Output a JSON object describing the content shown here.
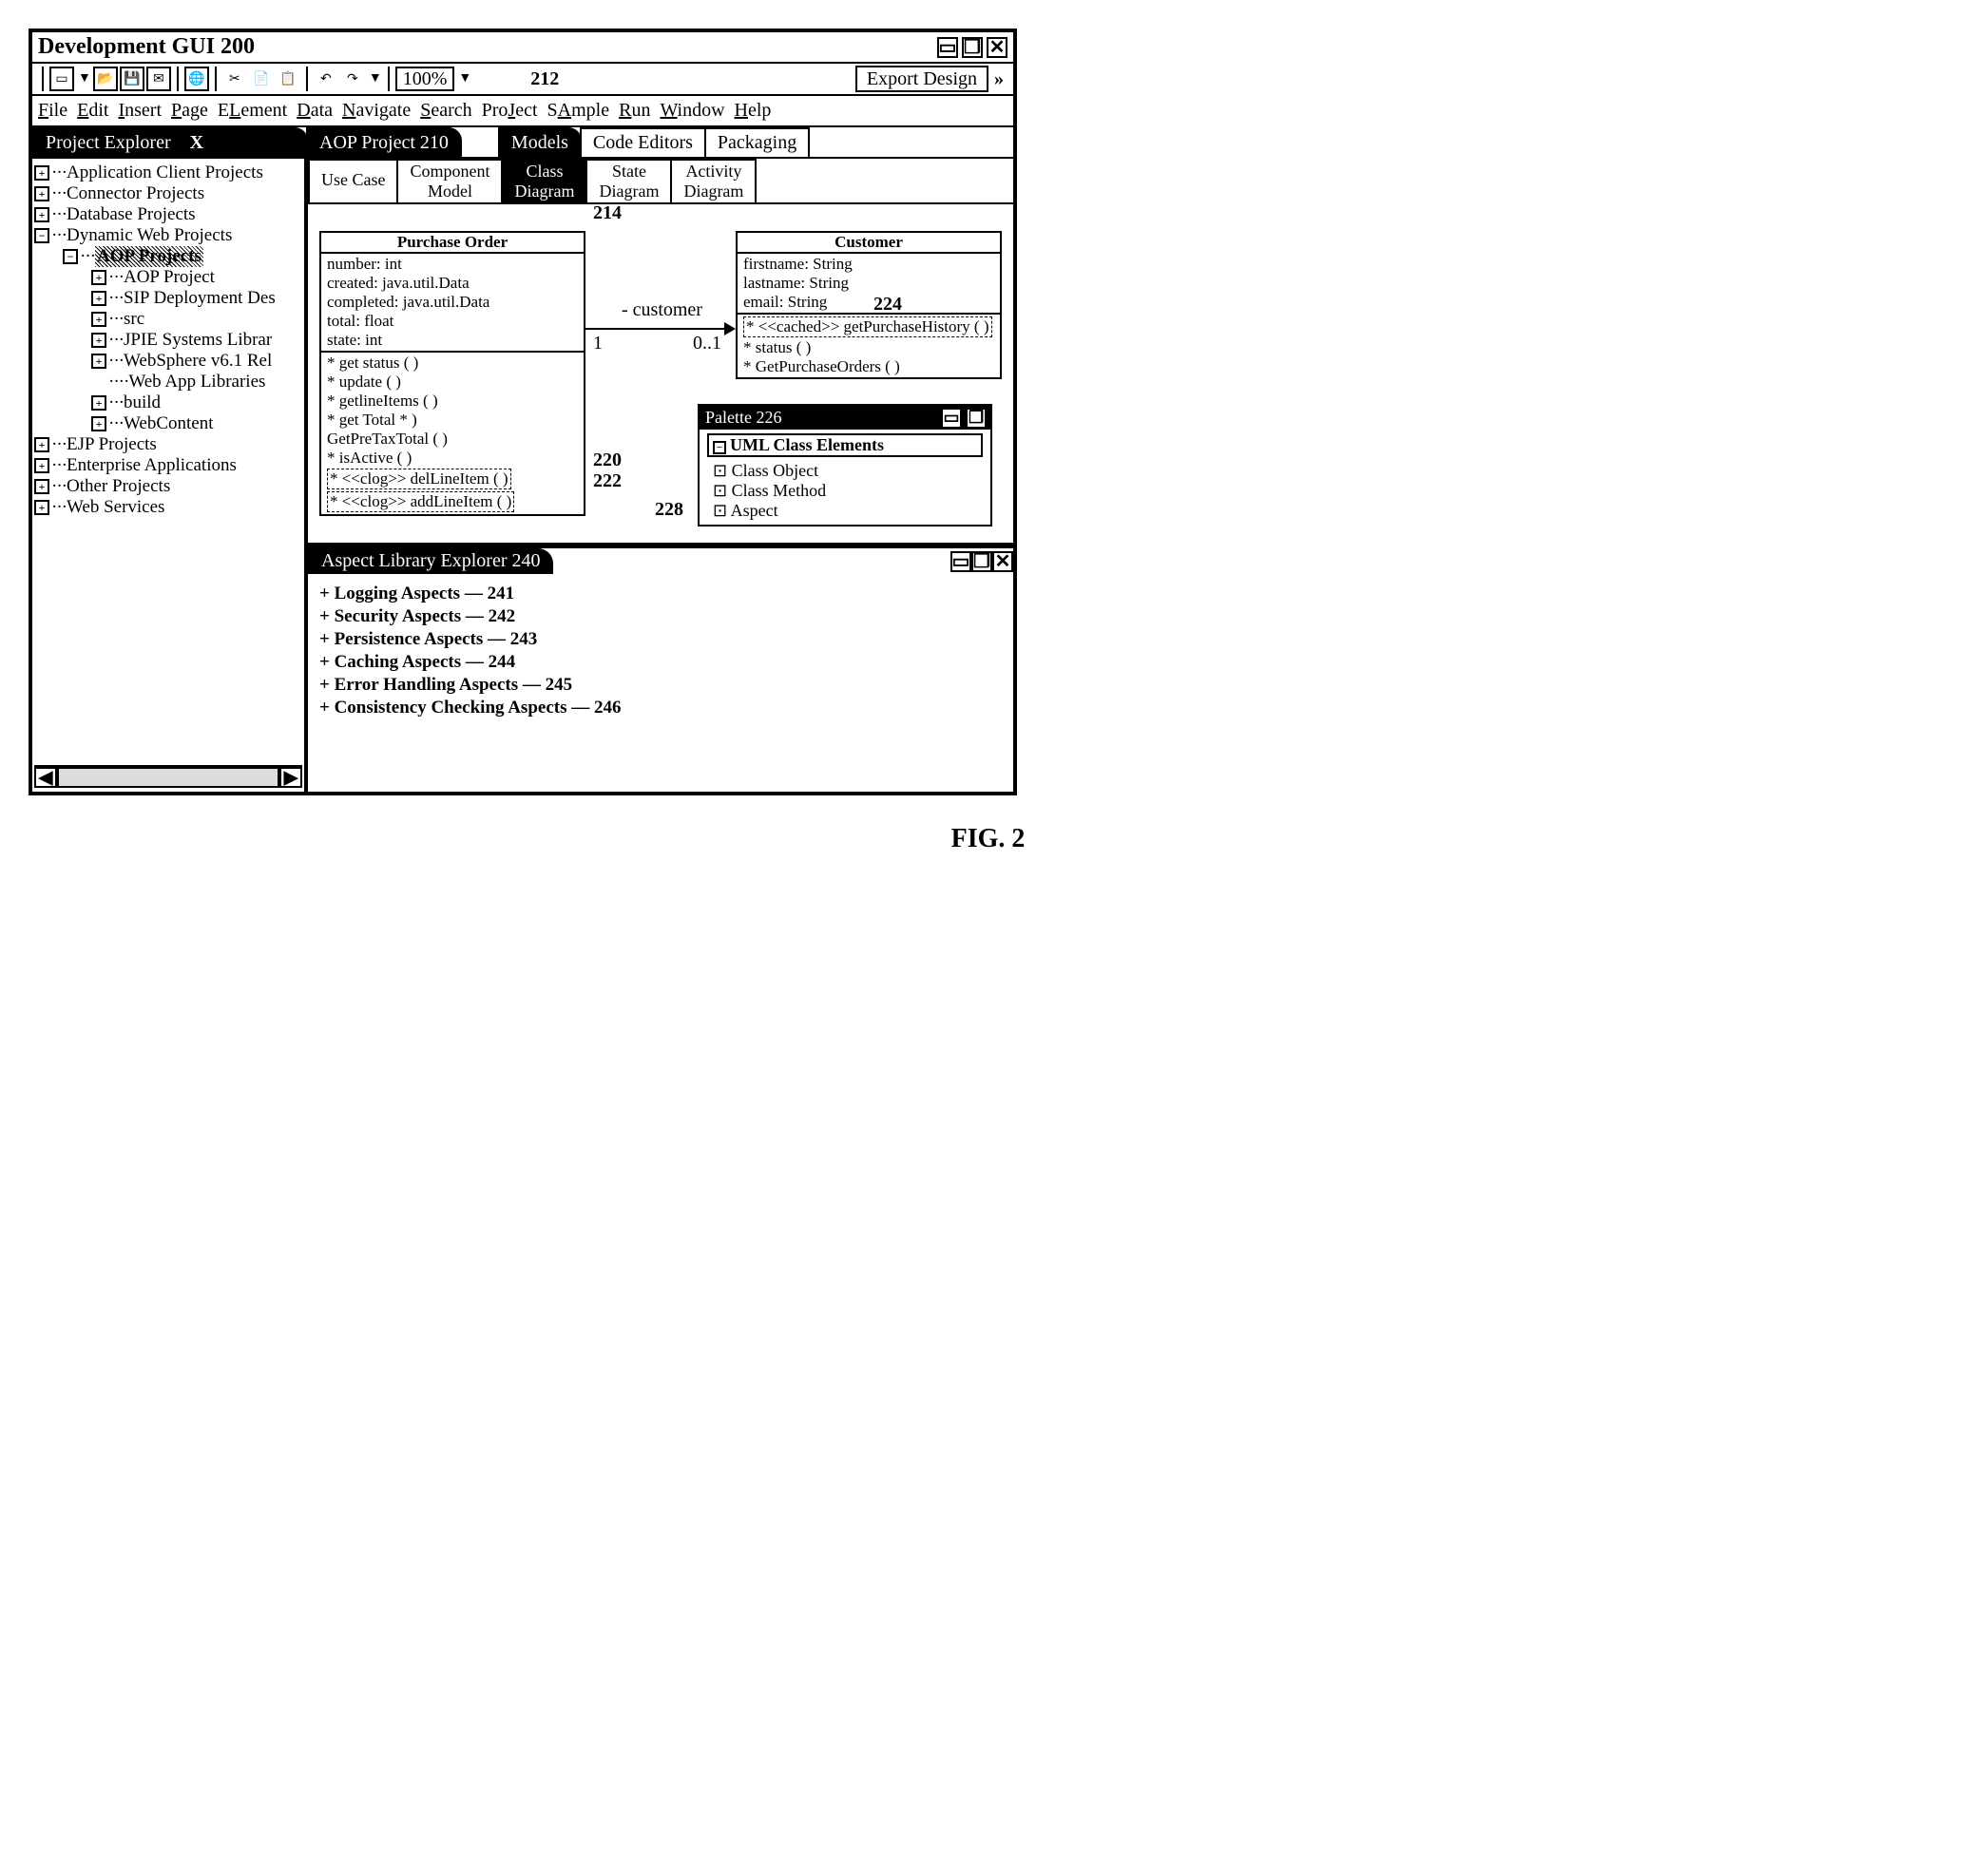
{
  "window": {
    "title": "Development GUI   200"
  },
  "toolbar": {
    "zoom": "100%",
    "export_label": "Export Design"
  },
  "menubar": [
    "File",
    "Edit",
    "Insert",
    "Page",
    "ELement",
    "Data",
    "Navigate",
    "Search",
    "ProJect",
    "SAmple",
    "Run",
    "Window",
    "Help"
  ],
  "topTabs": {
    "project_explorer": "Project Explorer",
    "aop_project": "AOP Project   210",
    "models": "Models",
    "code_editors": "Code Editors",
    "packaging": "Packaging",
    "annot_212": "212"
  },
  "subTabs": {
    "use_case": "Use Case",
    "component_model": "Component\nModel",
    "class_diagram": "Class\nDiagram",
    "state_diagram": "State\nDiagram",
    "activity_diagram": "Activity\nDiagram",
    "annot_214": "214"
  },
  "tree": {
    "app_client": "Application Client Projects",
    "connector": "Connector Projects",
    "database": "Database Projects",
    "dyn_web": "Dynamic Web Projects",
    "aop_projects": "AOP Projects",
    "aop_project": "AOP Project",
    "sip": "SIP Deployment Des",
    "src": "src",
    "jpie": "JPIE Systems Librar",
    "websphere": "WebSphere v6.1 Rel",
    "webapp": "Web App Libraries",
    "build": "build",
    "webcontent": "WebContent",
    "ejp": "EJP Projects",
    "ent_app": "Enterprise Applications",
    "other": "Other Projects",
    "web_svc": "Web Services"
  },
  "uml": {
    "po": {
      "title": "Purchase Order",
      "attrs": [
        "number: int",
        "created: java.util.Data",
        "completed: java.util.Data",
        "total: float",
        "state: int"
      ],
      "ops": [
        "* get status ( )",
        "* update ( )",
        "* getlineItems ( )",
        "* get Total * )",
        "GetPreTaxTotal ( )",
        "* isActive ( )"
      ],
      "aspect_ops": [
        "* <<clog>> delLineItem ( )",
        "* <<clog>> addLineItem ( )"
      ]
    },
    "customer": {
      "title": "Customer",
      "attrs": [
        "firstname: String",
        "lastname: String",
        "email: String"
      ],
      "aspect_ops": [
        "* <<cached>> getPurchaseHistory ( )"
      ],
      "ops": [
        "* status ( )",
        "* GetPurchaseOrders ( )"
      ]
    },
    "assoc": {
      "label": "- customer",
      "left_mult": "1",
      "right_mult": "0..1"
    },
    "annot_220": "220",
    "annot_222": "222",
    "annot_224": "224",
    "annot_228": "228"
  },
  "palette": {
    "title": "Palette    226",
    "group": "UML Class Elements",
    "items": [
      "Class Object",
      "Class Method",
      "Aspect"
    ]
  },
  "aspectLibrary": {
    "title": "Aspect Library Explorer    240",
    "items": [
      {
        "label": "Logging Aspects",
        "num": "241"
      },
      {
        "label": "Security Aspects",
        "num": "242"
      },
      {
        "label": "Persistence Aspects",
        "num": "243"
      },
      {
        "label": "Caching Aspects",
        "num": "244"
      },
      {
        "label": "Error Handling Aspects",
        "num": "245"
      },
      {
        "label": "Consistency Checking Aspects",
        "num": "246"
      }
    ]
  },
  "figure_label": "FIG. 2"
}
